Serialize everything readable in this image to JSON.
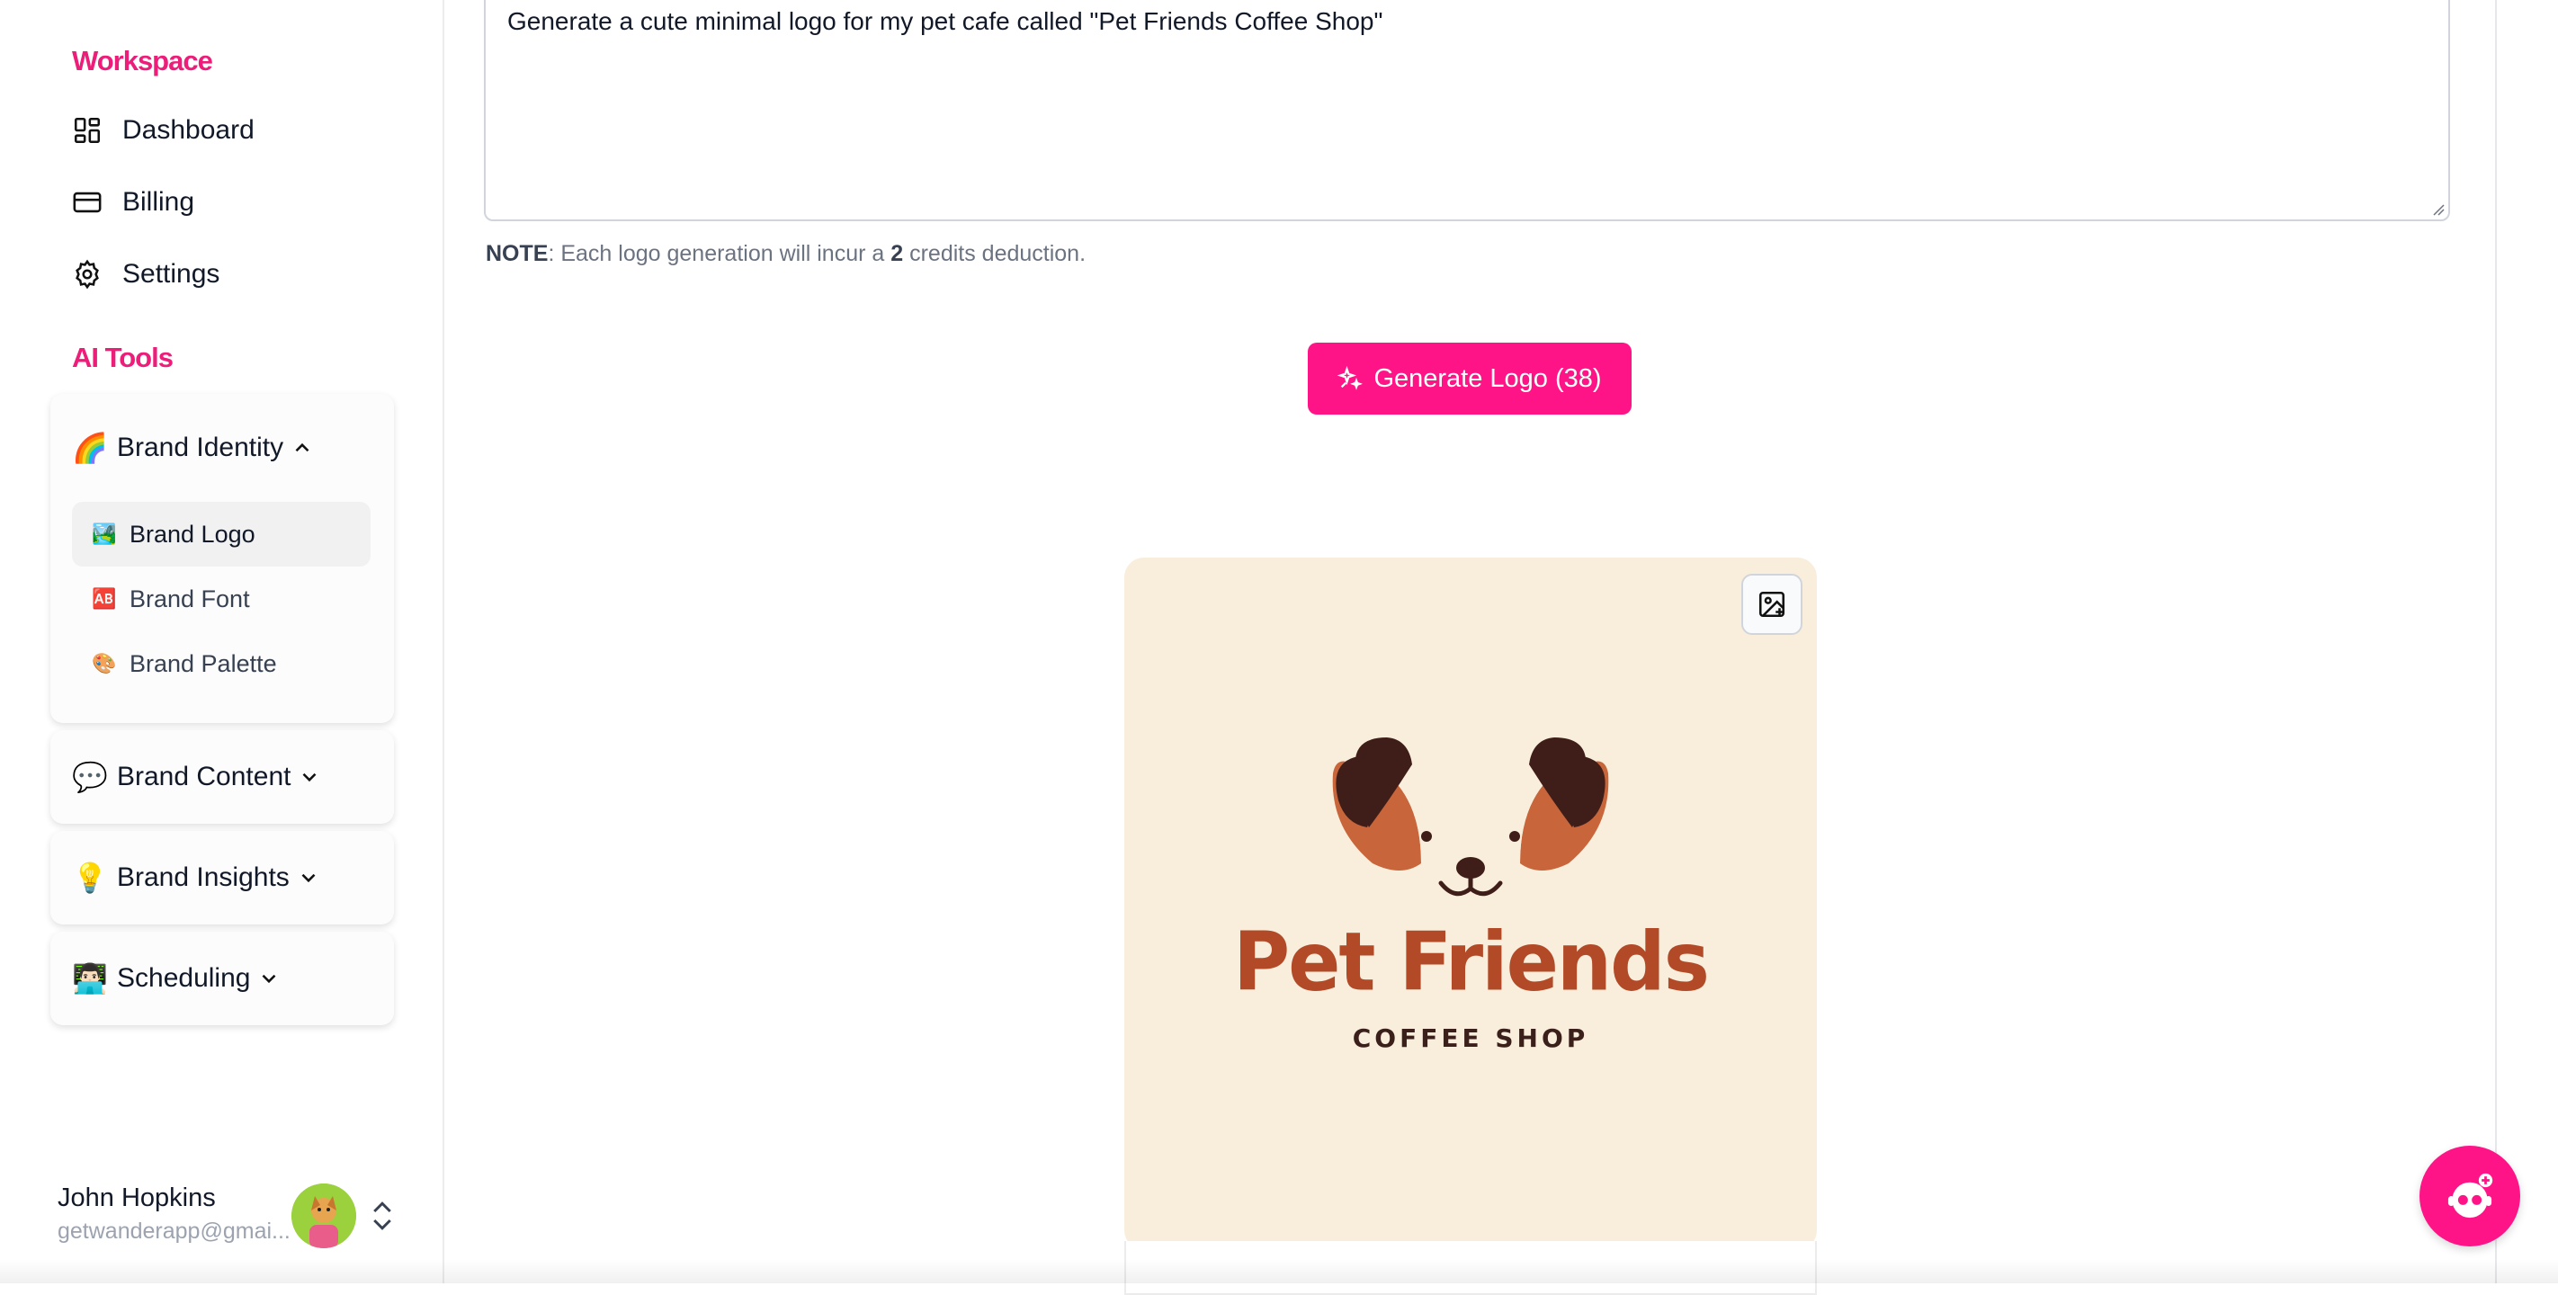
{
  "sidebar": {
    "workspace_title": "Workspace",
    "workspace_items": [
      {
        "label": "Dashboard",
        "icon": "dashboard-icon"
      },
      {
        "label": "Billing",
        "icon": "credit-card-icon"
      },
      {
        "label": "Settings",
        "icon": "gear-icon"
      }
    ],
    "ai_tools_title": "AI Tools",
    "groups": [
      {
        "emoji": "🌈",
        "label": "Brand Identity",
        "expanded": true,
        "items": [
          {
            "icon": "🏞️",
            "label": "Brand Logo",
            "active": true
          },
          {
            "icon": "🆎",
            "label": "Brand Font",
            "active": false
          },
          {
            "icon": "🎨",
            "label": "Brand Palette",
            "active": false
          }
        ]
      },
      {
        "emoji": "💬",
        "label": "Brand Content",
        "expanded": false
      },
      {
        "emoji": "💡",
        "label": "Brand Insights",
        "expanded": false
      },
      {
        "emoji": "👨🏻‍💻",
        "label": "Scheduling",
        "expanded": false
      }
    ],
    "user": {
      "name": "John Hopkins",
      "email": "getwanderapp@gmai..."
    }
  },
  "main": {
    "prompt_value": "Generate a cute minimal logo for my pet cafe called \"Pet Friends Coffee Shop\"",
    "note_label": "NOTE",
    "note_prefix": ": Each logo generation will incur a ",
    "note_credits": "2",
    "note_suffix": " credits deduction.",
    "generate_button_label": "Generate Logo (38)",
    "logo": {
      "title": "Pet Friends",
      "subtitle": "COFFEE SHOP"
    }
  },
  "colors": {
    "accent": "#ff1488",
    "section_title": "#ec1e79",
    "logo_background": "#f8eedb",
    "logo_brown": "#b24a28",
    "logo_dark": "#3a1f1a"
  }
}
